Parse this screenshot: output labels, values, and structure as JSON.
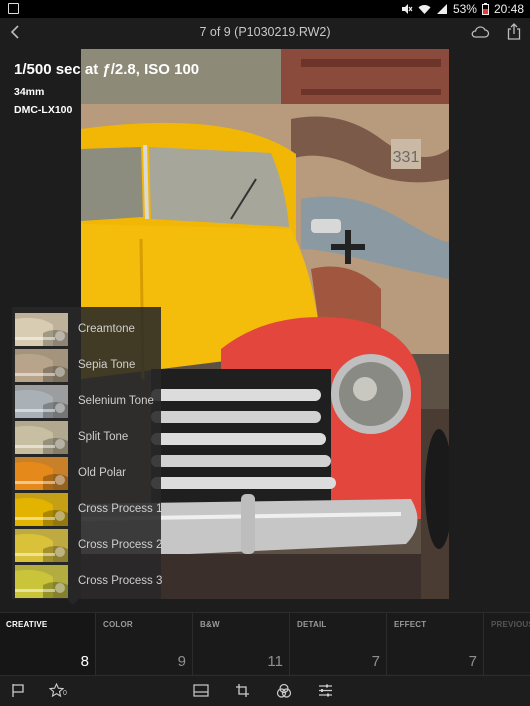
{
  "status_bar": {
    "battery": "53%",
    "time": "20:48"
  },
  "header": {
    "title": "7 of 9 (P1030219.RW2)"
  },
  "photo_info": {
    "exposure": "1/500 sec at ƒ/2.8, ISO 100",
    "focal_length": "34mm",
    "camera": "DMC-LX100"
  },
  "presets": [
    {
      "label": "Creamtone",
      "tint": "#d8ccb2"
    },
    {
      "label": "Sepia Tone",
      "tint": "#b7a48a"
    },
    {
      "label": "Selenium Tone",
      "tint": "#a9b0b6"
    },
    {
      "label": "Split Tone",
      "tint": "#c8bfa2"
    },
    {
      "label": "Old Polar",
      "tint": "#e58a1a"
    },
    {
      "label": "Cross Process 1",
      "tint": "#e2b400"
    },
    {
      "label": "Cross Process 2",
      "tint": "#d9c23a"
    },
    {
      "label": "Cross Process 3",
      "tint": "#c9c43a"
    }
  ],
  "tabs": [
    {
      "name": "CREATIVE",
      "count": "8"
    },
    {
      "name": "COLOR",
      "count": "9"
    },
    {
      "name": "B&W",
      "count": "11"
    },
    {
      "name": "DETAIL",
      "count": "7"
    },
    {
      "name": "EFFECT",
      "count": "7"
    },
    {
      "name": "PREVIOUS",
      "count": ""
    }
  ],
  "toolbar": {
    "rating_count": "0"
  },
  "colors": {
    "car_yellow": "#f2b705",
    "fender_red": "#e2463c",
    "background": "#1d1d1d"
  }
}
